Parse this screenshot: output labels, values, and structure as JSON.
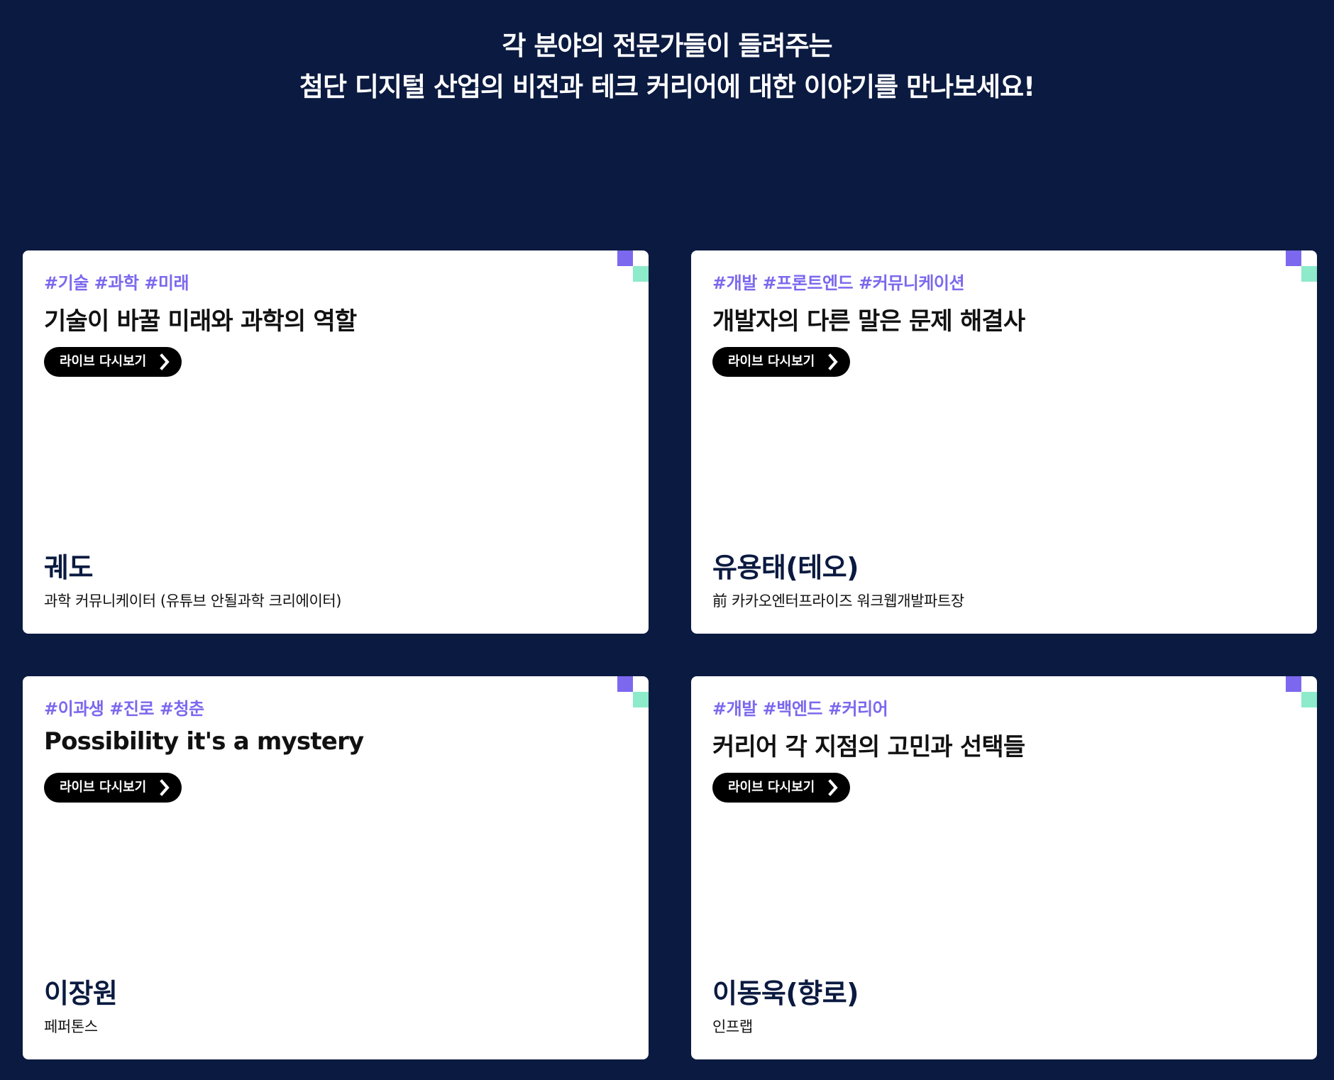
{
  "intro": {
    "line1": "각 분야의 전문가들이 들려주는",
    "line2": "첨단 디지털 산업의 비전과 테크 커리어에 대한 이야기를 만나보세요!"
  },
  "colors": {
    "background": "#0b1a40",
    "tag": "#7b68ee",
    "accent_purple": "#7b68ee",
    "accent_mint": "#8deacb",
    "button": "#000000"
  },
  "cards": [
    {
      "tags": "#기술 #과학 #미래",
      "title": "기술이 바꿀 미래와 과학의 역할",
      "button_label": "라이브 다시보기",
      "speaker": "궤도",
      "role": "과학 커뮤니케이터 (유튜브 안될과학 크리에이터)"
    },
    {
      "tags": "#개발 #프론트엔드 #커뮤니케이션",
      "title": "개발자의 다른 말은 문제 해결사",
      "button_label": "라이브 다시보기",
      "speaker": "유용태(테오)",
      "role": "前 카카오엔터프라이즈 워크웹개발파트장"
    },
    {
      "tags": "#이과생 #진로 #청춘",
      "title": "Possibility it's a mystery",
      "button_label": "라이브 다시보기",
      "speaker": "이장원",
      "role": "페퍼톤스"
    },
    {
      "tags": "#개발 #백엔드 #커리어",
      "title": "커리어 각 지점의 고민과 선택들",
      "button_label": "라이브 다시보기",
      "speaker": "이동욱(향로)",
      "role": "인프랩"
    }
  ]
}
